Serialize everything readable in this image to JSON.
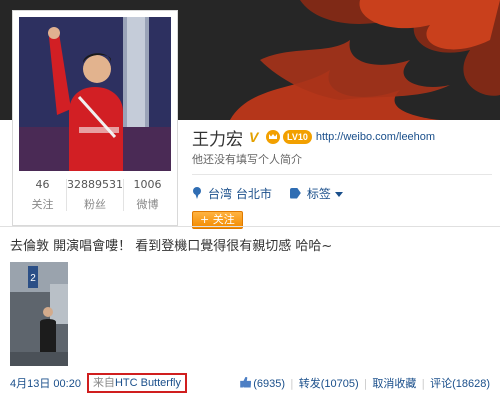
{
  "profile": {
    "name": "王力宏",
    "vip_level": "LV10",
    "url": "http://weibo.com/leehom",
    "bio": "他还没有填写个人简介",
    "location": "台湾 台北市",
    "tags_label": "标签",
    "follow_label": "+ 关注"
  },
  "stats": [
    {
      "value": "46",
      "label": "关注"
    },
    {
      "value": "32889531",
      "label": "粉丝"
    },
    {
      "value": "1006",
      "label": "微博"
    }
  ],
  "post": {
    "text": "去倫敦 開演唱會嘍！ 看到登機口覺得很有親切感 哈哈~",
    "timestamp": "4月13日 00:20",
    "source_prefix": "来自",
    "source_name": "HTC Butterfly",
    "likes": "(6935)",
    "repost": "转发(10705)",
    "cancel_favorite": "取消收藏",
    "comments": "评论(18628)"
  },
  "colors": {
    "banner": "#2a2a2a",
    "flame": "#c23b1a",
    "link": "#1a4f8b",
    "follow_button": "#f28a00",
    "source_highlight": "#d01e1e"
  }
}
